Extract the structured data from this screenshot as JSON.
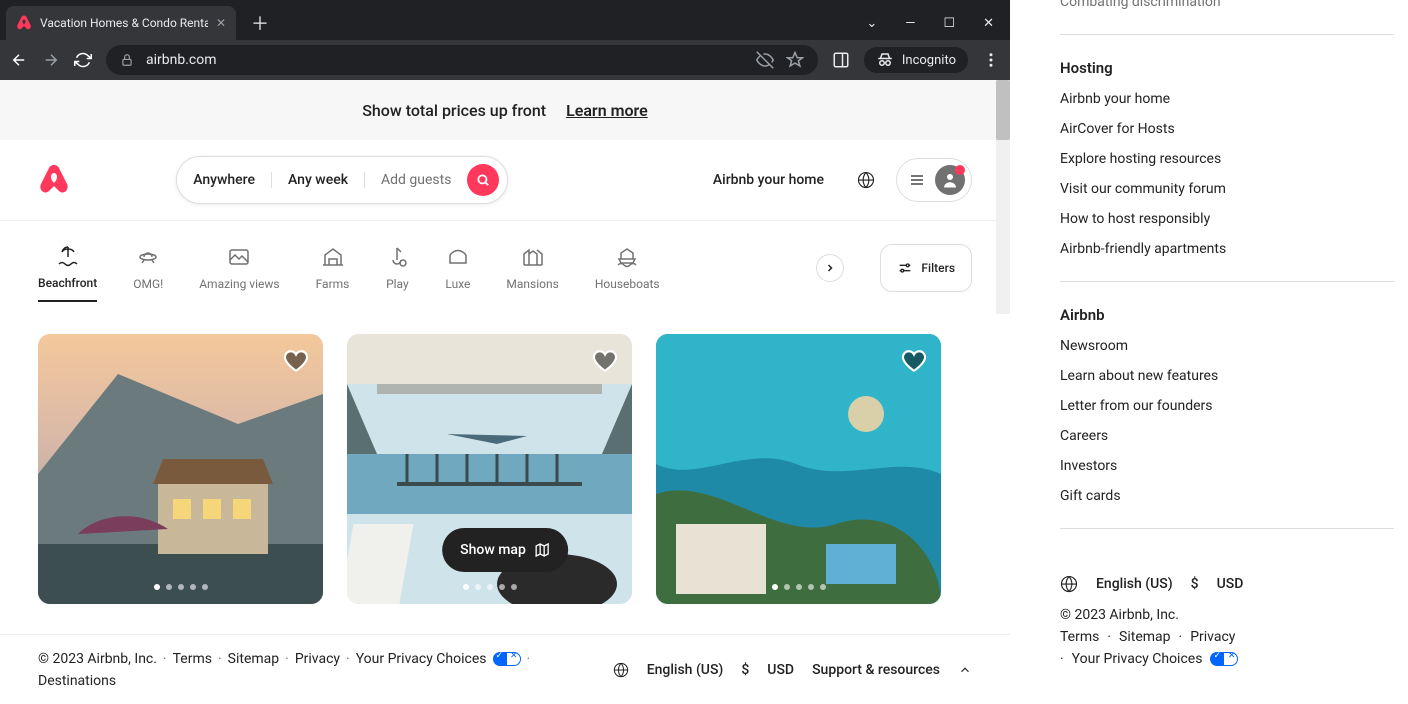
{
  "browser": {
    "tab_title": "Vacation Homes & Condo Rental",
    "url": "airbnb.com",
    "incognito_label": "Incognito"
  },
  "banner": {
    "text": "Show total prices up front",
    "learn_more": "Learn more"
  },
  "search": {
    "where": "Anywhere",
    "when": "Any week",
    "guests": "Add guests"
  },
  "header": {
    "airbnb_home": "Airbnb your home"
  },
  "categories": [
    "Beachfront",
    "OMG!",
    "Amazing views",
    "Farms",
    "Play",
    "Luxe",
    "Mansions",
    "Houseboats"
  ],
  "filters_label": "Filters",
  "show_map": "Show map",
  "footer": {
    "copyright": "© 2023 Airbnb, Inc.",
    "links": [
      "Terms",
      "Sitemap",
      "Privacy",
      "Your Privacy Choices"
    ],
    "destinations": "Destinations",
    "language": "English (US)",
    "currency_symbol": "$",
    "currency": "USD",
    "support": "Support & resources"
  },
  "right": {
    "top_cut": "Combating discrimination",
    "hosting": {
      "title": "Hosting",
      "items": [
        "Airbnb your home",
        "AirCover for Hosts",
        "Explore hosting resources",
        "Visit our community forum",
        "How to host responsibly",
        "Airbnb-friendly apartments"
      ]
    },
    "airbnb": {
      "title": "Airbnb",
      "items": [
        "Newsroom",
        "Learn about new features",
        "Letter from our founders",
        "Careers",
        "Investors",
        "Gift cards"
      ]
    },
    "language": "English (US)",
    "currency_symbol": "$",
    "currency": "USD",
    "copyright": "© 2023 Airbnb, Inc.",
    "legal": [
      "Terms",
      "Sitemap",
      "Privacy"
    ],
    "privacy_choices": "Your Privacy Choices"
  }
}
